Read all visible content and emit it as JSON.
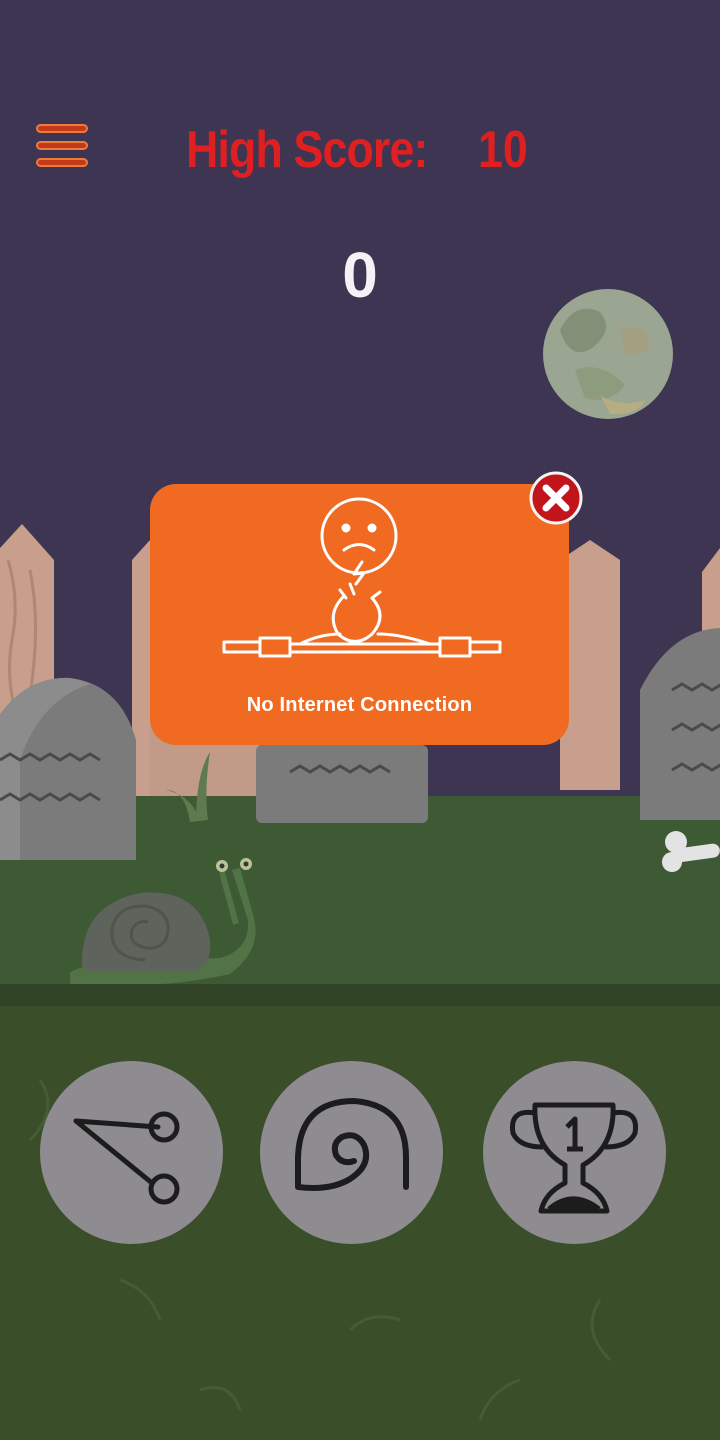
{
  "header": {
    "menu_icon": "hamburger-menu-icon",
    "high_score_label": "High Score:",
    "high_score_value": "10"
  },
  "game": {
    "current_score": "0"
  },
  "dialog": {
    "icon": "no-internet-icon",
    "message": "No Internet Connection",
    "close_icon": "close-icon"
  },
  "actions": [
    {
      "name": "share",
      "icon": "share-icon"
    },
    {
      "name": "snail",
      "icon": "spiral-shell-icon"
    },
    {
      "name": "leaderboard",
      "icon": "trophy-icon"
    }
  ],
  "colors": {
    "sky": "#3d3552",
    "accent_red": "#e02020",
    "popup_orange": "#f06a22",
    "grass": "#3e5a34",
    "ground": "#3a4e2a",
    "button_gray": "#8f8c91"
  }
}
